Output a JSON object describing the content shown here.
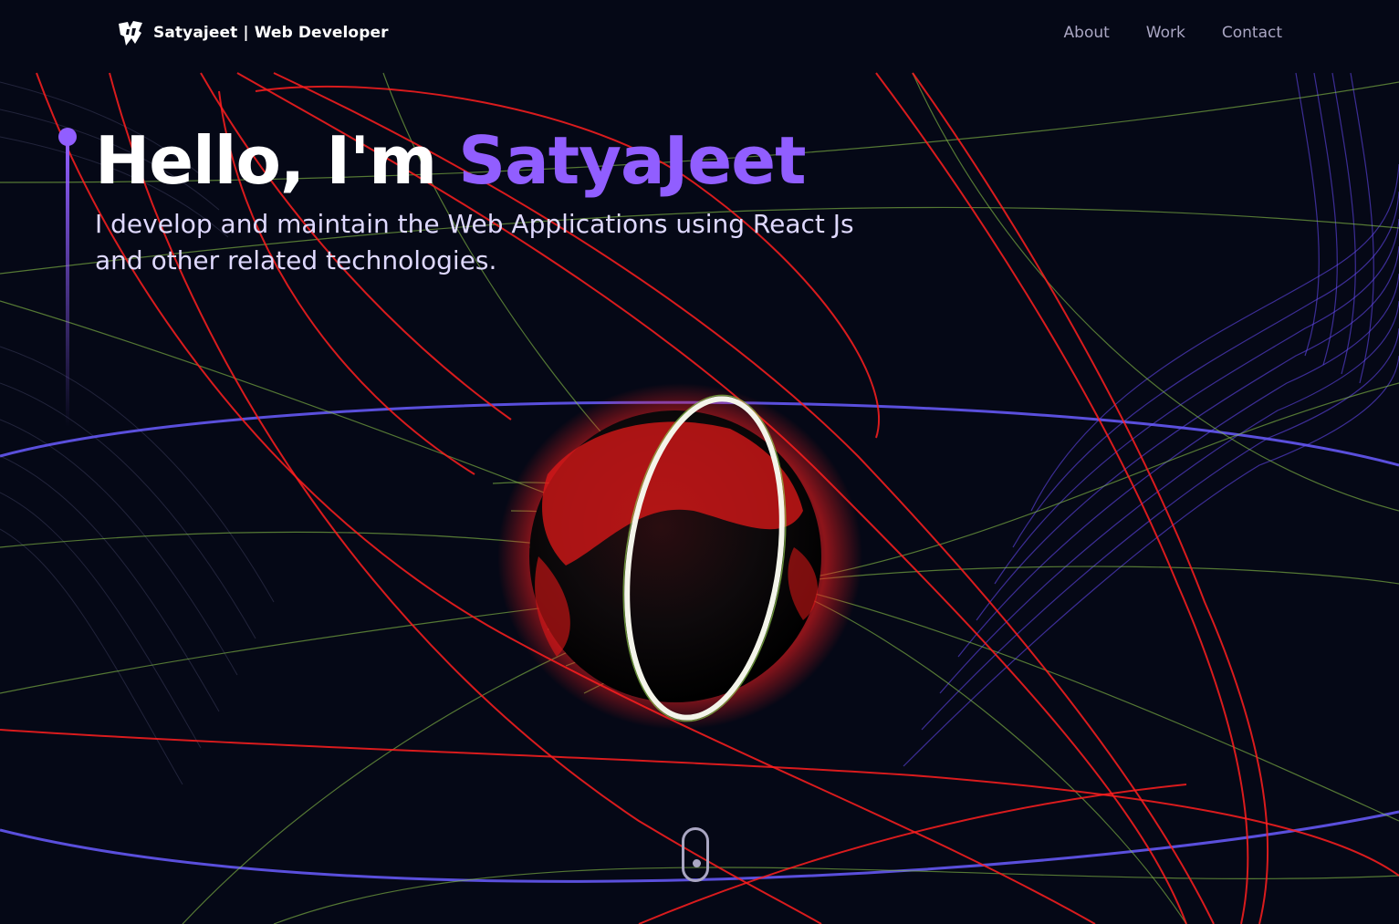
{
  "navbar": {
    "brand_name": "Satyajeet",
    "brand_separator": "|",
    "brand_role": "Web Developer",
    "logo_icon": "logo-icon",
    "links": [
      {
        "label": "About"
      },
      {
        "label": "Work"
      },
      {
        "label": "Contact"
      }
    ]
  },
  "hero": {
    "greeting": "Hello, I'm ",
    "name": "SatyaJeet",
    "subtitle_line1": "I develop and maintain the Web Applications using React Js",
    "subtitle_line2": "and other related technologies."
  },
  "scroll": {
    "icon": "mouse-scroll-icon"
  },
  "colors": {
    "background": "#050816",
    "accent": "#915eff",
    "nav_text": "#aaa6c3",
    "globe_glow": "#ff2020",
    "orbit_green": "#8bc34a",
    "orbit_blue": "#6a5cff"
  }
}
